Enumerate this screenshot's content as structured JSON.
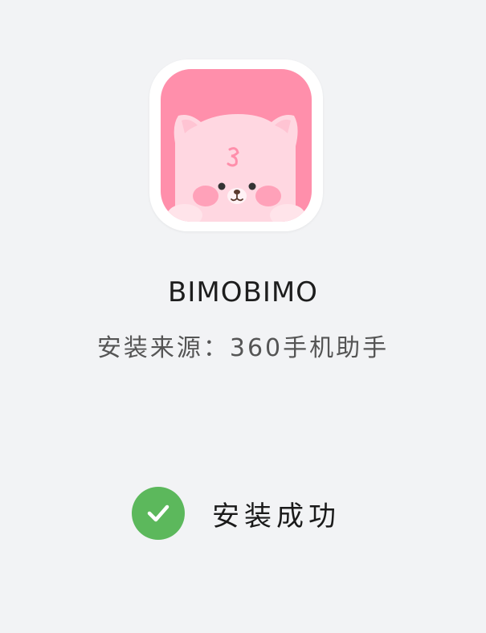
{
  "app": {
    "name": "BIMOBIMO",
    "icon": "pink-cat-app-icon",
    "install_source": "安装来源：360手机助手"
  },
  "status": {
    "icon": "check-circle-icon",
    "text": "安装成功",
    "color": "#5cb85c"
  },
  "colors": {
    "background": "#f2f3f5",
    "icon_pink": "#ff8fab"
  }
}
